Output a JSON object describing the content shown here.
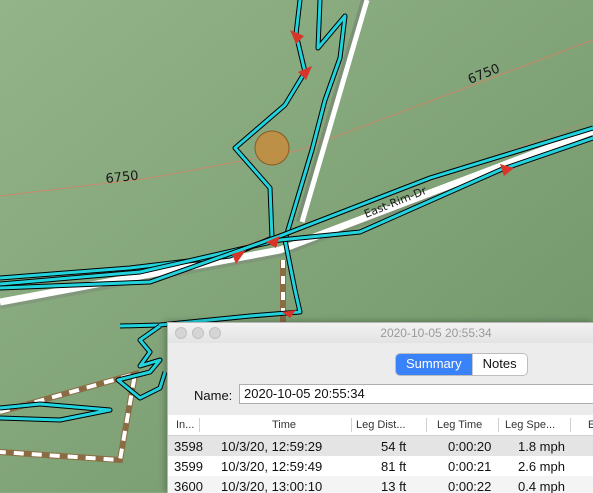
{
  "map": {
    "contour_labels": [
      "6750",
      "6750"
    ],
    "road_label": "East-Rim-Dr",
    "colors": {
      "track": "#22d3dd",
      "road": "#ffffff",
      "marker": "#d8352a",
      "contour": "#c8896b",
      "highlight": "#c98a3a"
    }
  },
  "window": {
    "title": "2020-10-05 20:55:34",
    "tabs": {
      "summary": "Summary",
      "notes": "Notes",
      "active": "Summary"
    },
    "name_label": "Name:",
    "name_value": "2020-10-05 20:55:34",
    "columns": [
      "In...",
      "Time",
      "Leg Dist...",
      "Leg Time",
      "Leg Spe...",
      "E"
    ],
    "rows": [
      {
        "index": "3598",
        "time": "10/3/20, 12:59:29",
        "leg_dist": "54 ft",
        "leg_time": "0:00:20",
        "leg_speed": "1.8 mph"
      },
      {
        "index": "3599",
        "time": "10/3/20, 12:59:49",
        "leg_dist": "81 ft",
        "leg_time": "0:00:21",
        "leg_speed": "2.6 mph"
      },
      {
        "index": "3600",
        "time": "10/3/20, 13:00:10",
        "leg_dist": "13 ft",
        "leg_time": "0:00:22",
        "leg_speed": "0.4 mph"
      }
    ]
  }
}
